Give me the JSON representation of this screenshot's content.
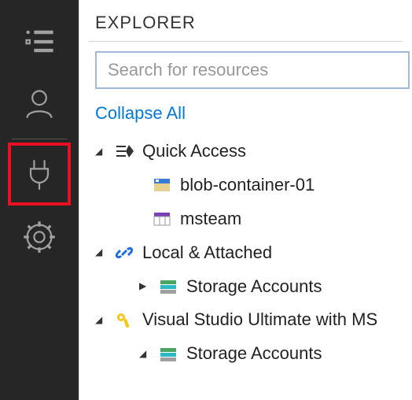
{
  "header": {
    "title": "EXPLORER"
  },
  "search": {
    "placeholder": "Search for resources",
    "value": ""
  },
  "actions": {
    "collapse_all": "Collapse All"
  },
  "tree": {
    "quick_access": {
      "label": "Quick Access",
      "expanded": true,
      "items": [
        {
          "label": "blob-container-01",
          "icon": "blob-container-icon"
        },
        {
          "label": "msteam",
          "icon": "table-icon"
        }
      ]
    },
    "local_attached": {
      "label": "Local & Attached",
      "expanded": true,
      "children": [
        {
          "label": "Storage Accounts",
          "expanded": false,
          "icon": "storage-stack-icon"
        }
      ]
    },
    "subscription": {
      "label": "Visual Studio Ultimate with MS",
      "expanded": true,
      "icon": "key-icon",
      "children": [
        {
          "label": "Storage Accounts",
          "expanded": true,
          "icon": "storage-stack-icon"
        }
      ]
    }
  },
  "activity_bar": {
    "items": [
      {
        "name": "explorer",
        "selected": false
      },
      {
        "name": "account",
        "selected": false
      },
      {
        "name": "connect",
        "selected": true
      },
      {
        "name": "settings",
        "selected": false
      }
    ]
  }
}
